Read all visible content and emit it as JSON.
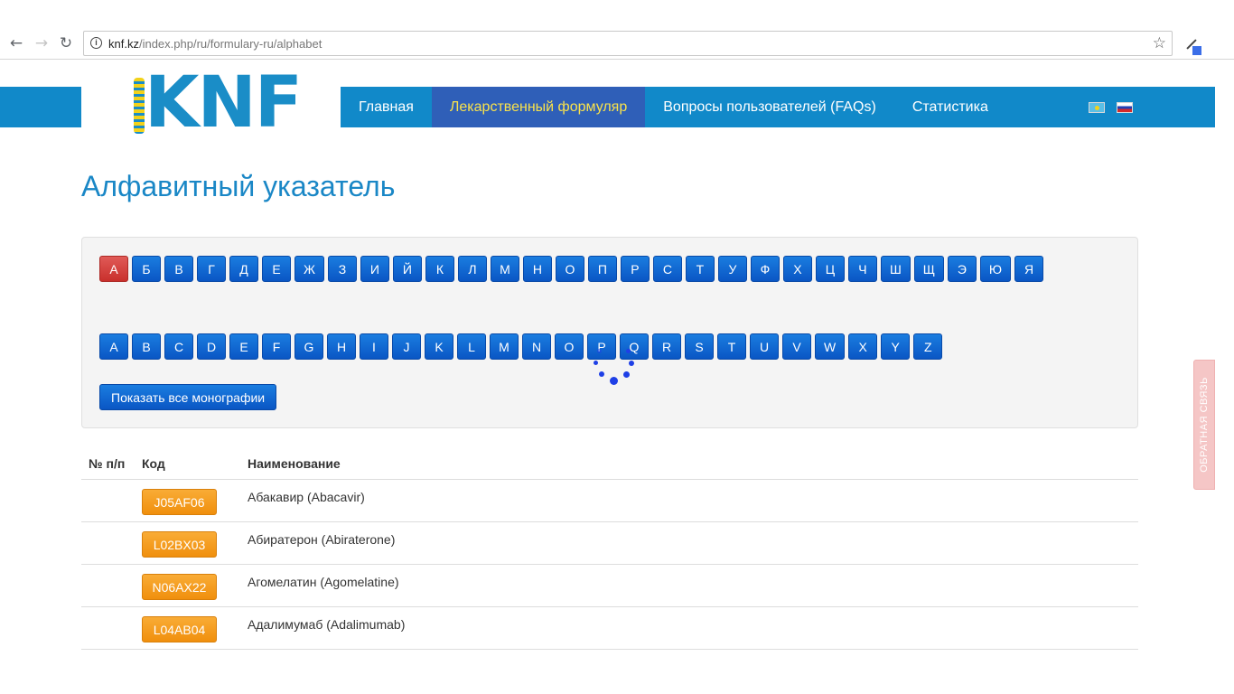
{
  "browser": {
    "url_host": "knf.kz",
    "url_path": "/index.php/ru/formulary-ru/alphabet"
  },
  "site": {
    "logo_text": "KNF",
    "menu": [
      {
        "label": "Главная"
      },
      {
        "label": "Лекарственный формуляр"
      },
      {
        "label": "Вопросы пользователей (FAQs)"
      },
      {
        "label": "Статистика"
      }
    ],
    "languages": [
      "kz-flag",
      "ru-flag"
    ]
  },
  "page": {
    "title": "Алфавитный указатель",
    "cyrillic_letters": [
      "А",
      "Б",
      "В",
      "Г",
      "Д",
      "Е",
      "Ж",
      "З",
      "И",
      "Й",
      "К",
      "Л",
      "М",
      "Н",
      "О",
      "П",
      "Р",
      "С",
      "Т",
      "У",
      "Ф",
      "Х",
      "Ц",
      "Ч",
      "Ш",
      "Щ",
      "Э",
      "Ю",
      "Я"
    ],
    "selected_letter": "А",
    "latin_letters": [
      "A",
      "B",
      "C",
      "D",
      "E",
      "F",
      "G",
      "H",
      "I",
      "J",
      "K",
      "L",
      "M",
      "N",
      "O",
      "P",
      "Q",
      "R",
      "S",
      "T",
      "U",
      "V",
      "W",
      "X",
      "Y",
      "Z"
    ],
    "show_all_label": "Показать все монографии"
  },
  "table": {
    "headers": {
      "num": "№ п/п",
      "code": "Код",
      "name": "Наименование"
    },
    "rows": [
      {
        "num": "",
        "code": "J05AF06",
        "name": "Абакавир (Abacavir)"
      },
      {
        "num": "",
        "code": "L02BX03",
        "name": "Абиратерон (Abiraterone)"
      },
      {
        "num": "",
        "code": "N06AX22",
        "name": "Агомелатин (Agomelatine)"
      },
      {
        "num": "",
        "code": "L04AB04",
        "name": "Адалимумаб (Adalimumab)"
      }
    ]
  },
  "feedback_label": "ОБРАТНАЯ СВЯЗЬ",
  "colors": {
    "brand": "#1189c9",
    "active_menu": "#2f5fb8",
    "selected_letter": "#c9302c",
    "code_button": "#f08f0d"
  }
}
